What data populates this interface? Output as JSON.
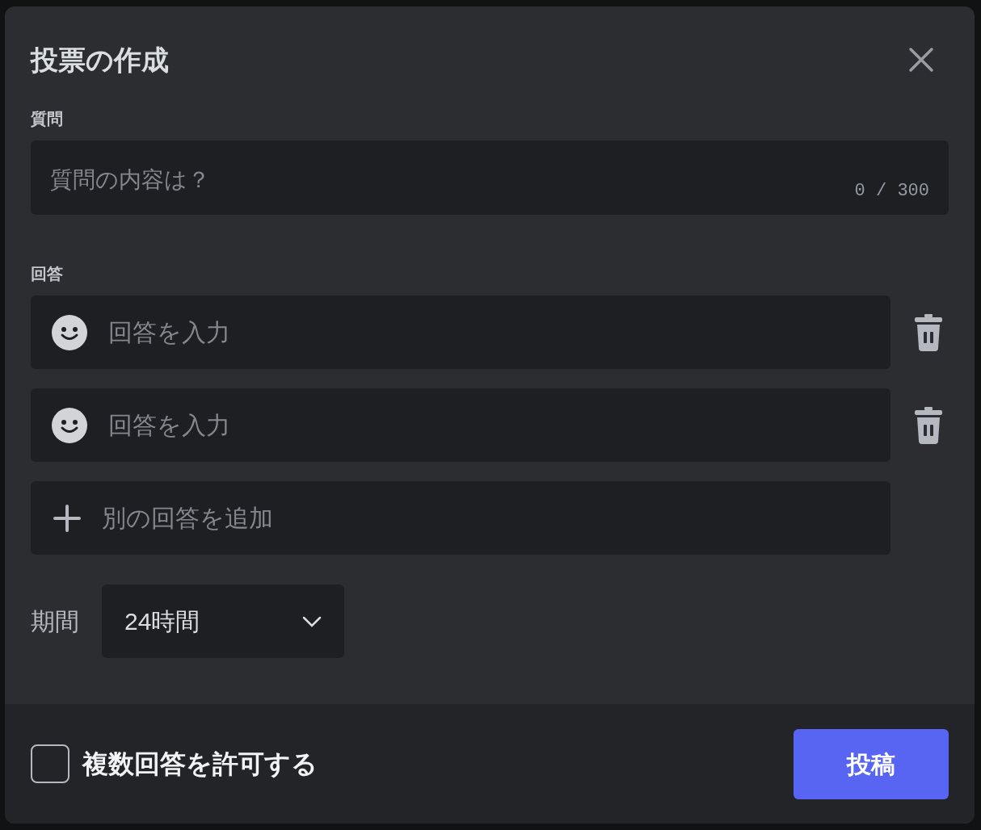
{
  "dialog": {
    "title": "投票の作成"
  },
  "question": {
    "label": "質問",
    "placeholder": "質問の内容は？",
    "counter": "0 / 300"
  },
  "answers": {
    "label": "回答",
    "items": [
      {
        "placeholder": "回答を入力"
      },
      {
        "placeholder": "回答を入力"
      }
    ],
    "add_label": "別の回答を追加"
  },
  "duration": {
    "label": "期間",
    "value": "24時間"
  },
  "footer": {
    "multiple": {
      "label": "複数回答を許可する",
      "checked": false
    },
    "submit": "投稿"
  }
}
